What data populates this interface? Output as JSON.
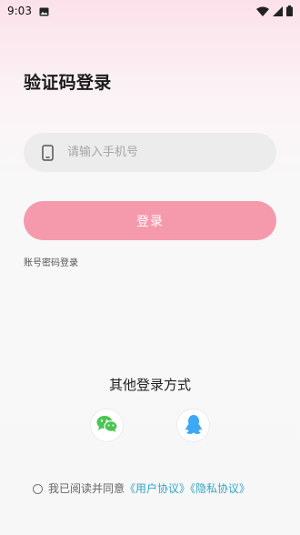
{
  "status_bar": {
    "time": "9:03"
  },
  "page": {
    "title": "验证码登录"
  },
  "phone_input": {
    "placeholder": "请输入手机号",
    "value": ""
  },
  "login_button": {
    "label": "登录"
  },
  "password_login_link": {
    "label": "账号密码登录"
  },
  "other_login": {
    "title": "其他登录方式",
    "options": [
      {
        "name": "wechat",
        "icon": "wechat-icon",
        "color": "#4cc552"
      },
      {
        "name": "qq",
        "icon": "qq-penguin-icon",
        "color": "#3da8f5"
      }
    ]
  },
  "agreement": {
    "checked": false,
    "prefix": "我已阅读并同意",
    "user_agreement": "《用户协议》",
    "privacy_policy": "《隐私协议》"
  },
  "colors": {
    "accent_pink": "#f59aac",
    "link_blue": "#35a6c7",
    "input_bg": "#ececec"
  }
}
